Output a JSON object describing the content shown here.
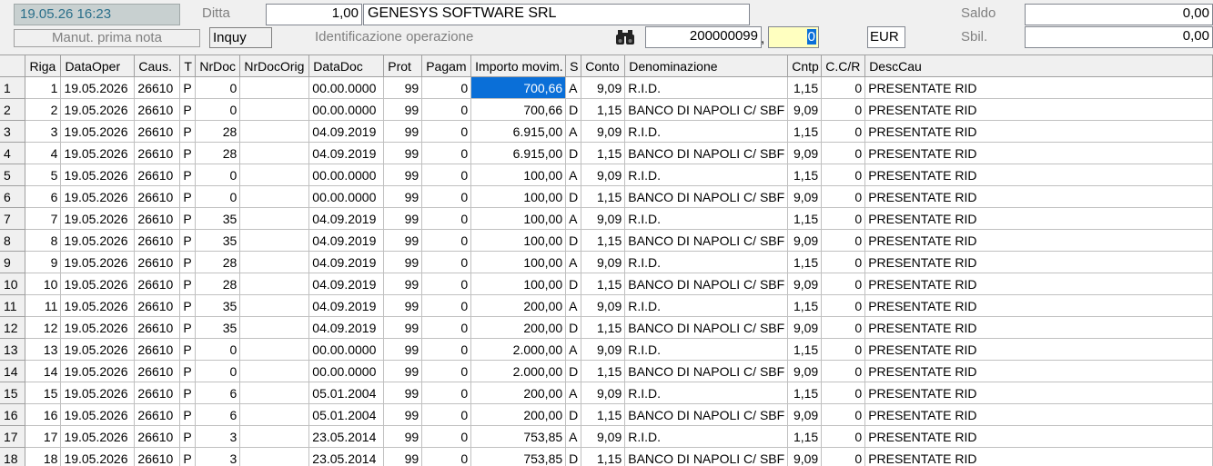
{
  "header": {
    "datetime": "19.05.26 16:23",
    "ditta_label": "Ditta",
    "ditta_code": "1,00",
    "company_name": "GENESYS SOFTWARE SRL",
    "saldo_label": "Saldo",
    "saldo_value": "0,00",
    "mode_label": "Manut. prima nota",
    "status_field": "Inquy",
    "operation_label": "Identificazione operazione",
    "binoculars_icon": "binoculars-icon",
    "operation_number": "200000099",
    "comma": ",",
    "operation_suffix": "0",
    "currency": "EUR",
    "sbil_label": "Sbil.",
    "sbil_value": "0,00"
  },
  "table": {
    "columns": [
      "",
      "Riga",
      "DataOper",
      "Caus.",
      "T",
      "NrDoc",
      "NrDocOrig",
      "DataDoc",
      "Prot",
      "Pagam",
      "Importo movim.",
      "S",
      "Conto",
      "Denominazione",
      "Cntp",
      "C.C/R",
      "DescCau"
    ],
    "rows": [
      [
        "1",
        "1",
        "19.05.2026",
        "26610",
        "P",
        "0",
        "",
        "00.00.0000",
        "99",
        "0",
        "700,66",
        "A",
        "9,09",
        "R.I.D.",
        "1,15",
        "0",
        "PRESENTATE RID"
      ],
      [
        "2",
        "2",
        "19.05.2026",
        "26610",
        "P",
        "0",
        "",
        "00.00.0000",
        "99",
        "0",
        "700,66",
        "D",
        "1,15",
        "BANCO DI NAPOLI C/ SBF",
        "9,09",
        "0",
        "PRESENTATE RID"
      ],
      [
        "3",
        "3",
        "19.05.2026",
        "26610",
        "P",
        "28",
        "",
        "04.09.2019",
        "99",
        "0",
        "6.915,00",
        "A",
        "9,09",
        "R.I.D.",
        "1,15",
        "0",
        "PRESENTATE RID"
      ],
      [
        "4",
        "4",
        "19.05.2026",
        "26610",
        "P",
        "28",
        "",
        "04.09.2019",
        "99",
        "0",
        "6.915,00",
        "D",
        "1,15",
        "BANCO DI NAPOLI C/ SBF",
        "9,09",
        "0",
        "PRESENTATE RID"
      ],
      [
        "5",
        "5",
        "19.05.2026",
        "26610",
        "P",
        "0",
        "",
        "00.00.0000",
        "99",
        "0",
        "100,00",
        "A",
        "9,09",
        "R.I.D.",
        "1,15",
        "0",
        "PRESENTATE RID"
      ],
      [
        "6",
        "6",
        "19.05.2026",
        "26610",
        "P",
        "0",
        "",
        "00.00.0000",
        "99",
        "0",
        "100,00",
        "D",
        "1,15",
        "BANCO DI NAPOLI C/ SBF",
        "9,09",
        "0",
        "PRESENTATE RID"
      ],
      [
        "7",
        "7",
        "19.05.2026",
        "26610",
        "P",
        "35",
        "",
        "04.09.2019",
        "99",
        "0",
        "100,00",
        "A",
        "9,09",
        "R.I.D.",
        "1,15",
        "0",
        "PRESENTATE RID"
      ],
      [
        "8",
        "8",
        "19.05.2026",
        "26610",
        "P",
        "35",
        "",
        "04.09.2019",
        "99",
        "0",
        "100,00",
        "D",
        "1,15",
        "BANCO DI NAPOLI C/ SBF",
        "9,09",
        "0",
        "PRESENTATE RID"
      ],
      [
        "9",
        "9",
        "19.05.2026",
        "26610",
        "P",
        "28",
        "",
        "04.09.2019",
        "99",
        "0",
        "100,00",
        "A",
        "9,09",
        "R.I.D.",
        "1,15",
        "0",
        "PRESENTATE RID"
      ],
      [
        "10",
        "10",
        "19.05.2026",
        "26610",
        "P",
        "28",
        "",
        "04.09.2019",
        "99",
        "0",
        "100,00",
        "D",
        "1,15",
        "BANCO DI NAPOLI C/ SBF",
        "9,09",
        "0",
        "PRESENTATE RID"
      ],
      [
        "11",
        "11",
        "19.05.2026",
        "26610",
        "P",
        "35",
        "",
        "04.09.2019",
        "99",
        "0",
        "200,00",
        "A",
        "9,09",
        "R.I.D.",
        "1,15",
        "0",
        "PRESENTATE RID"
      ],
      [
        "12",
        "12",
        "19.05.2026",
        "26610",
        "P",
        "35",
        "",
        "04.09.2019",
        "99",
        "0",
        "200,00",
        "D",
        "1,15",
        "BANCO DI NAPOLI C/ SBF",
        "9,09",
        "0",
        "PRESENTATE RID"
      ],
      [
        "13",
        "13",
        "19.05.2026",
        "26610",
        "P",
        "0",
        "",
        "00.00.0000",
        "99",
        "0",
        "2.000,00",
        "A",
        "9,09",
        "R.I.D.",
        "1,15",
        "0",
        "PRESENTATE RID"
      ],
      [
        "14",
        "14",
        "19.05.2026",
        "26610",
        "P",
        "0",
        "",
        "00.00.0000",
        "99",
        "0",
        "2.000,00",
        "D",
        "1,15",
        "BANCO DI NAPOLI C/ SBF",
        "9,09",
        "0",
        "PRESENTATE RID"
      ],
      [
        "15",
        "15",
        "19.05.2026",
        "26610",
        "P",
        "6",
        "",
        "05.01.2004",
        "99",
        "0",
        "200,00",
        "A",
        "9,09",
        "R.I.D.",
        "1,15",
        "0",
        "PRESENTATE RID"
      ],
      [
        "16",
        "16",
        "19.05.2026",
        "26610",
        "P",
        "6",
        "",
        "05.01.2004",
        "99",
        "0",
        "200,00",
        "D",
        "1,15",
        "BANCO DI NAPOLI C/ SBF",
        "9,09",
        "0",
        "PRESENTATE RID"
      ],
      [
        "17",
        "17",
        "19.05.2026",
        "26610",
        "P",
        "3",
        "",
        "23.05.2014",
        "99",
        "0",
        "753,85",
        "A",
        "9,09",
        "R.I.D.",
        "1,15",
        "0",
        "PRESENTATE RID"
      ],
      [
        "18",
        "18",
        "19.05.2026",
        "26610",
        "P",
        "3",
        "",
        "23.05.2014",
        "99",
        "0",
        "753,85",
        "D",
        "1,15",
        "BANCO DI NAPOLI C/ SBF",
        "9,09",
        "0",
        "PRESENTATE RID"
      ]
    ]
  },
  "colors": {
    "selection": "#0a6fd8",
    "datetime_bg": "#c8d0d0",
    "datetime_text": "#2a6f8a",
    "active_field_bg": "#ffffc0"
  }
}
